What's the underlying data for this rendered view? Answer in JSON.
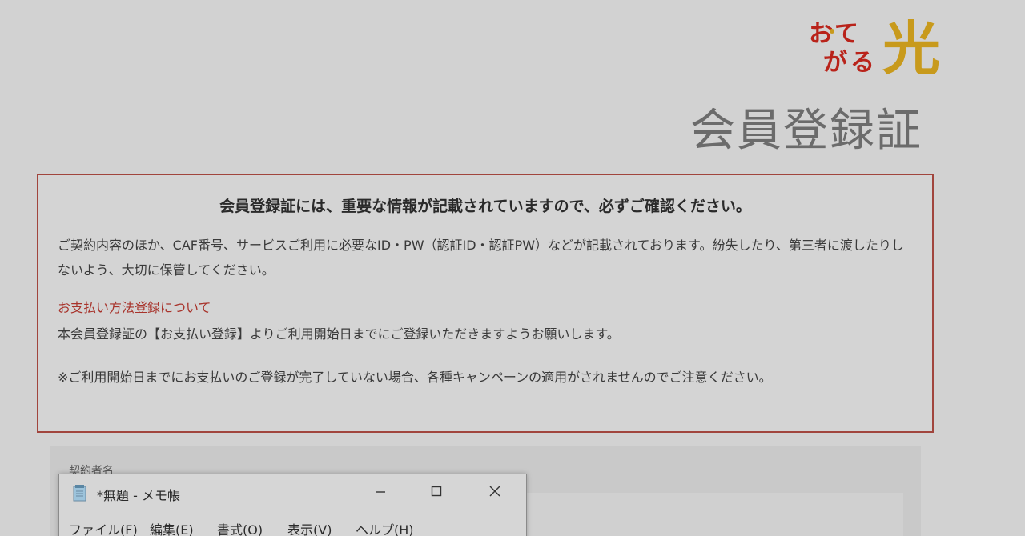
{
  "logo": {
    "text_top": "おてがる",
    "text_kanji": "光",
    "colors": {
      "red": "#b9231a",
      "gold": "#c89a1c"
    }
  },
  "document": {
    "title": "会員登録証"
  },
  "notice": {
    "heading": "会員登録証には、重要な情報が記載されていますので、必ずご確認ください。",
    "paragraph1": "ご契約内容のほか、CAF番号、サービスご利用に必要なID・PW（認証ID・認証PW）などが記載されております。紛失したり、第三者に渡したりしないよう、大切に保管してください。",
    "payment_heading": "お支払い方法登録について",
    "paragraph2": "本会員登録証の【お支払い登録】よりご利用開始日までにご登録いただきますようお願いします。",
    "paragraph3": "※ご利用開始日までにお支払いのご登録が完了していない場合、各種キャンペーンの適用がされませんのでご注意ください。",
    "colors": {
      "border": "#a1453d",
      "heading_red": "#a8332b"
    }
  },
  "lower_panel": {
    "label": "契約者名"
  },
  "notepad": {
    "title": "*無題 - メモ帳",
    "icon": "notepad-icon",
    "controls": {
      "minimize": "minimize-icon",
      "maximize": "maximize-icon",
      "close": "close-icon"
    },
    "menus": [
      "ファイル(F)",
      "編集(E)",
      "書式(O)",
      "表示(V)",
      "ヘルプ(H)"
    ]
  }
}
